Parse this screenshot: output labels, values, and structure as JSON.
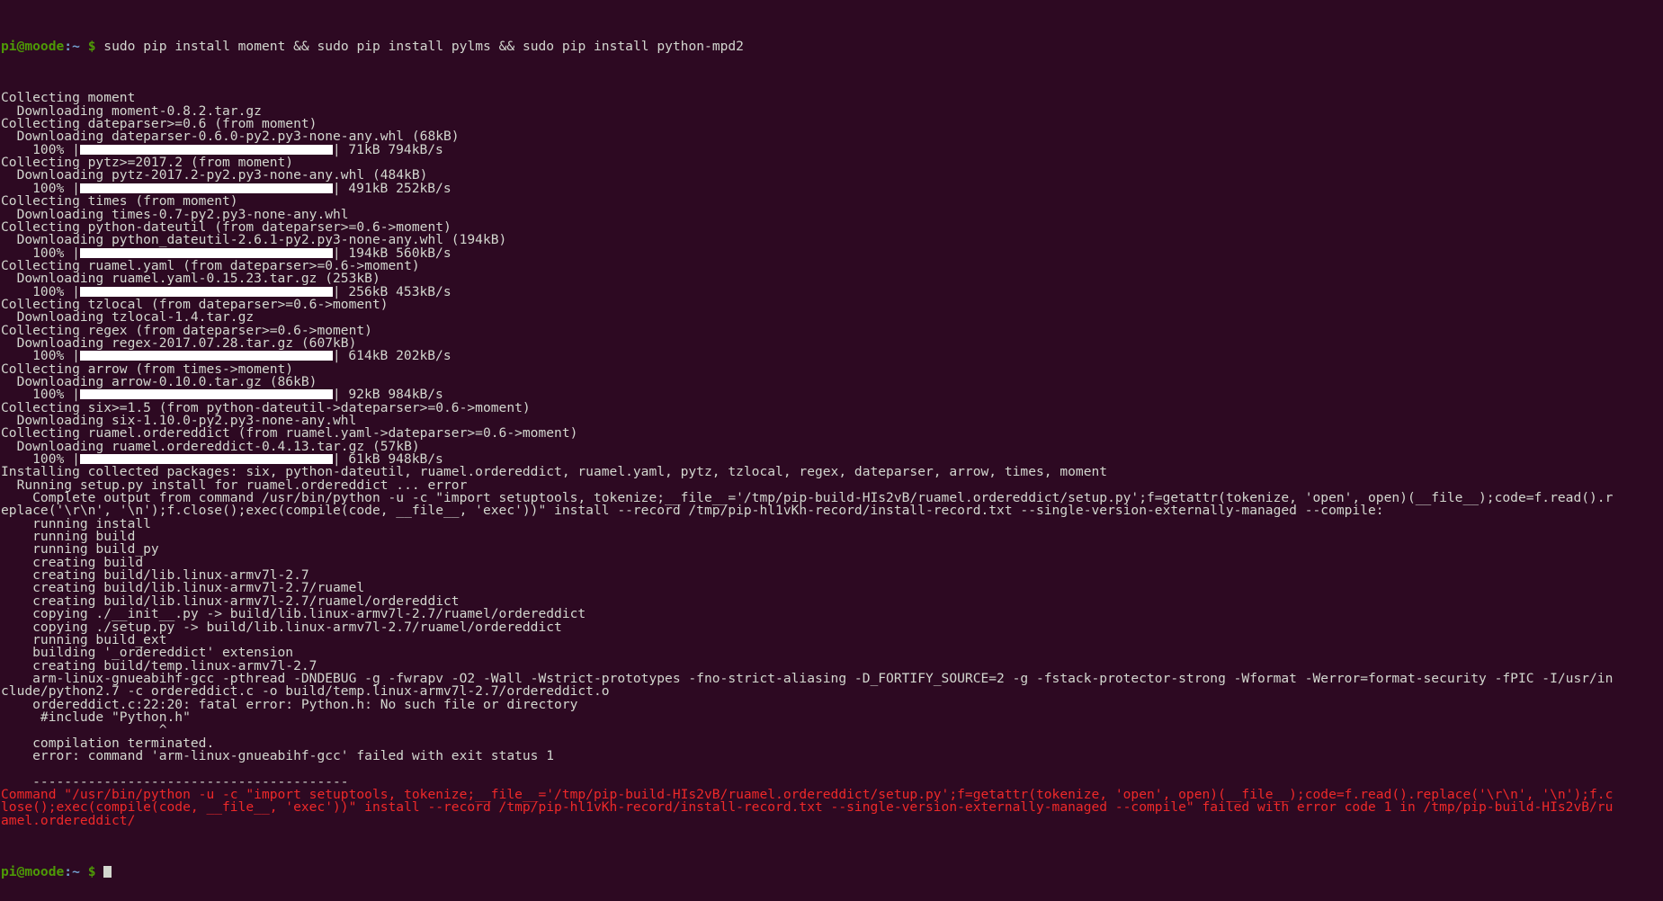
{
  "terminal": {
    "title": "pi@moode: ~",
    "colors": {
      "background": "#2d0922",
      "foreground": "#d3d7cf",
      "prompt_user": "#4e9a06",
      "prompt_path": "#729fcf",
      "error": "#ef2929",
      "progress_bar": "#ffffff"
    },
    "prompt": {
      "user_host": "pi@moode",
      "separator": ":",
      "path": "~",
      "dollar": "$"
    },
    "command": "sudo pip install moment && sudo pip install pylms && sudo pip install python-mpd2",
    "lines": [
      {
        "type": "out",
        "text": "Collecting moment"
      },
      {
        "type": "out",
        "text": "  Downloading moment-0.8.2.tar.gz"
      },
      {
        "type": "out",
        "text": "Collecting dateparser>=0.6 (from moment)"
      },
      {
        "type": "out",
        "text": "  Downloading dateparser-0.6.0-py2.py3-none-any.whl (68kB)"
      },
      {
        "type": "bar",
        "pre": "    100% |",
        "bar_chars": 32,
        "post": "| 71kB 794kB/s"
      },
      {
        "type": "out",
        "text": "Collecting pytz>=2017.2 (from moment)"
      },
      {
        "type": "out",
        "text": "  Downloading pytz-2017.2-py2.py3-none-any.whl (484kB)"
      },
      {
        "type": "bar",
        "pre": "    100% |",
        "bar_chars": 32,
        "post": "| 491kB 252kB/s"
      },
      {
        "type": "out",
        "text": "Collecting times (from moment)"
      },
      {
        "type": "out",
        "text": "  Downloading times-0.7-py2.py3-none-any.whl"
      },
      {
        "type": "out",
        "text": "Collecting python-dateutil (from dateparser>=0.6->moment)"
      },
      {
        "type": "out",
        "text": "  Downloading python_dateutil-2.6.1-py2.py3-none-any.whl (194kB)"
      },
      {
        "type": "bar",
        "pre": "    100% |",
        "bar_chars": 32,
        "post": "| 194kB 560kB/s"
      },
      {
        "type": "out",
        "text": "Collecting ruamel.yaml (from dateparser>=0.6->moment)"
      },
      {
        "type": "out",
        "text": "  Downloading ruamel.yaml-0.15.23.tar.gz (253kB)"
      },
      {
        "type": "bar",
        "pre": "    100% |",
        "bar_chars": 32,
        "post": "| 256kB 453kB/s"
      },
      {
        "type": "out",
        "text": "Collecting tzlocal (from dateparser>=0.6->moment)"
      },
      {
        "type": "out",
        "text": "  Downloading tzlocal-1.4.tar.gz"
      },
      {
        "type": "out",
        "text": "Collecting regex (from dateparser>=0.6->moment)"
      },
      {
        "type": "out",
        "text": "  Downloading regex-2017.07.28.tar.gz (607kB)"
      },
      {
        "type": "bar",
        "pre": "    100% |",
        "bar_chars": 32,
        "post": "| 614kB 202kB/s"
      },
      {
        "type": "out",
        "text": "Collecting arrow (from times->moment)"
      },
      {
        "type": "out",
        "text": "  Downloading arrow-0.10.0.tar.gz (86kB)"
      },
      {
        "type": "bar",
        "pre": "    100% |",
        "bar_chars": 32,
        "post": "| 92kB 984kB/s"
      },
      {
        "type": "out",
        "text": "Collecting six>=1.5 (from python-dateutil->dateparser>=0.6->moment)"
      },
      {
        "type": "out",
        "text": "  Downloading six-1.10.0-py2.py3-none-any.whl"
      },
      {
        "type": "out",
        "text": "Collecting ruamel.ordereddict (from ruamel.yaml->dateparser>=0.6->moment)"
      },
      {
        "type": "out",
        "text": "  Downloading ruamel.ordereddict-0.4.13.tar.gz (57kB)"
      },
      {
        "type": "bar",
        "pre": "    100% |",
        "bar_chars": 32,
        "post": "| 61kB 948kB/s"
      },
      {
        "type": "out",
        "text": "Installing collected packages: six, python-dateutil, ruamel.ordereddict, ruamel.yaml, pytz, tzlocal, regex, dateparser, arrow, times, moment"
      },
      {
        "type": "out",
        "text": "  Running setup.py install for ruamel.ordereddict ... error"
      },
      {
        "type": "out",
        "text": "    Complete output from command /usr/bin/python -u -c \"import setuptools, tokenize;__file__='/tmp/pip-build-HIs2vB/ruamel.ordereddict/setup.py';f=getattr(tokenize, 'open', open)(__file__);code=f.read().r"
      },
      {
        "type": "out",
        "text": "eplace('\\r\\n', '\\n');f.close();exec(compile(code, __file__, 'exec'))\" install --record /tmp/pip-hl1vKh-record/install-record.txt --single-version-externally-managed --compile:"
      },
      {
        "type": "out",
        "text": "    running install"
      },
      {
        "type": "out",
        "text": "    running build"
      },
      {
        "type": "out",
        "text": "    running build_py"
      },
      {
        "type": "out",
        "text": "    creating build"
      },
      {
        "type": "out",
        "text": "    creating build/lib.linux-armv7l-2.7"
      },
      {
        "type": "out",
        "text": "    creating build/lib.linux-armv7l-2.7/ruamel"
      },
      {
        "type": "out",
        "text": "    creating build/lib.linux-armv7l-2.7/ruamel/ordereddict"
      },
      {
        "type": "out",
        "text": "    copying ./__init__.py -> build/lib.linux-armv7l-2.7/ruamel/ordereddict"
      },
      {
        "type": "out",
        "text": "    copying ./setup.py -> build/lib.linux-armv7l-2.7/ruamel/ordereddict"
      },
      {
        "type": "out",
        "text": "    running build_ext"
      },
      {
        "type": "out",
        "text": "    building '_ordereddict' extension"
      },
      {
        "type": "out",
        "text": "    creating build/temp.linux-armv7l-2.7"
      },
      {
        "type": "out",
        "text": "    arm-linux-gnueabihf-gcc -pthread -DNDEBUG -g -fwrapv -O2 -Wall -Wstrict-prototypes -fno-strict-aliasing -D_FORTIFY_SOURCE=2 -g -fstack-protector-strong -Wformat -Werror=format-security -fPIC -I/usr/in"
      },
      {
        "type": "out",
        "text": "clude/python2.7 -c ordereddict.c -o build/temp.linux-armv7l-2.7/ordereddict.o"
      },
      {
        "type": "out",
        "text": "    ordereddict.c:22:20: fatal error: Python.h: No such file or directory"
      },
      {
        "type": "out",
        "text": "     #include \"Python.h\""
      },
      {
        "type": "out",
        "text": "                    ^"
      },
      {
        "type": "out",
        "text": "    compilation terminated."
      },
      {
        "type": "out",
        "text": "    error: command 'arm-linux-gnueabihf-gcc' failed with exit status 1"
      },
      {
        "type": "out",
        "text": "    "
      },
      {
        "type": "out",
        "text": "    ----------------------------------------"
      },
      {
        "type": "err",
        "text": "Command \"/usr/bin/python -u -c \"import setuptools, tokenize;__file__='/tmp/pip-build-HIs2vB/ruamel.ordereddict/setup.py';f=getattr(tokenize, 'open', open)(__file__);code=f.read().replace('\\r\\n', '\\n');f.c"
      },
      {
        "type": "err",
        "text": "lose();exec(compile(code, __file__, 'exec'))\" install --record /tmp/pip-hl1vKh-record/install-record.txt --single-version-externally-managed --compile\" failed with error code 1 in /tmp/pip-build-HIs2vB/ru"
      },
      {
        "type": "err",
        "text": "amel.ordereddict/"
      }
    ]
  }
}
